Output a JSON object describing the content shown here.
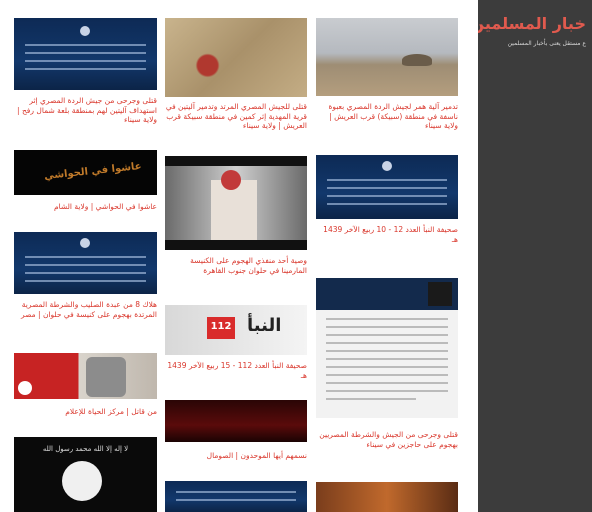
{
  "sidebar": {
    "title": "خبار المسلمين",
    "subtitle": "ع مستقل يعنى بأخبار المسلمين",
    "items": [
      "",
      "",
      "",
      "",
      "",
      "",
      "",
      ""
    ]
  },
  "cards": {
    "c1": {
      "caption": "قتلى وجرحى من جيش الردة المصري إثر استهداف آليتين لهم بمنطقة بلعة شمال رفح | ولاية سيناء"
    },
    "c2": {
      "caption": "قتلى للجيش المصري المرتد وتدمير آليتين في قرية المهدية إثر كمين في منطقة سبيكة قرب العريش | ولاية سيناء"
    },
    "c3": {
      "caption": "تدمير آلية همر لجيش الردة المصري بعبوة ناسفة في منطقة (سبيكة) قرب العريش | ولاية سيناء"
    },
    "c4": {
      "caption": "عاشوا في الحواشي | ولاية الشام"
    },
    "c5": {
      "caption": "وصية أحد منفذي الهجوم على الكنيسة المارمينا في حلوان جنوب القاهرة"
    },
    "c6": {
      "caption": "صحيفة النبأ العدد 12 - 10 ربيع الآخر 1439 هـ"
    },
    "c7": {
      "caption": "هلاك 8 من عبدة الصليب والشرطة المصرية المرتدة بهجوم على كنيسة في حلوان | مصر"
    },
    "c8": {
      "caption": "صحيفة النبأ العدد 112 - 15 ربيع الآخر 1439 هـ"
    },
    "c9": {
      "caption": "من قاتل | مركز الحياة للإعلام"
    },
    "c10": {
      "caption": "قتلى وجرحى من الجيش والشرطة المصريين بهجوم على حاجزين في سيناء"
    },
    "c11": {
      "caption": "نسمهم أيها الموحدون | الصومال"
    },
    "c12": {
      "caption": ""
    },
    "c13": {
      "caption": ""
    },
    "c14": {
      "caption": ""
    }
  },
  "thumbs": {
    "naba_number": "112",
    "naba_logo": "النبأ",
    "flag_text": "لا إله إلا الله محمد رسول الله",
    "banner_text": "عاشوا في الحواشي"
  }
}
